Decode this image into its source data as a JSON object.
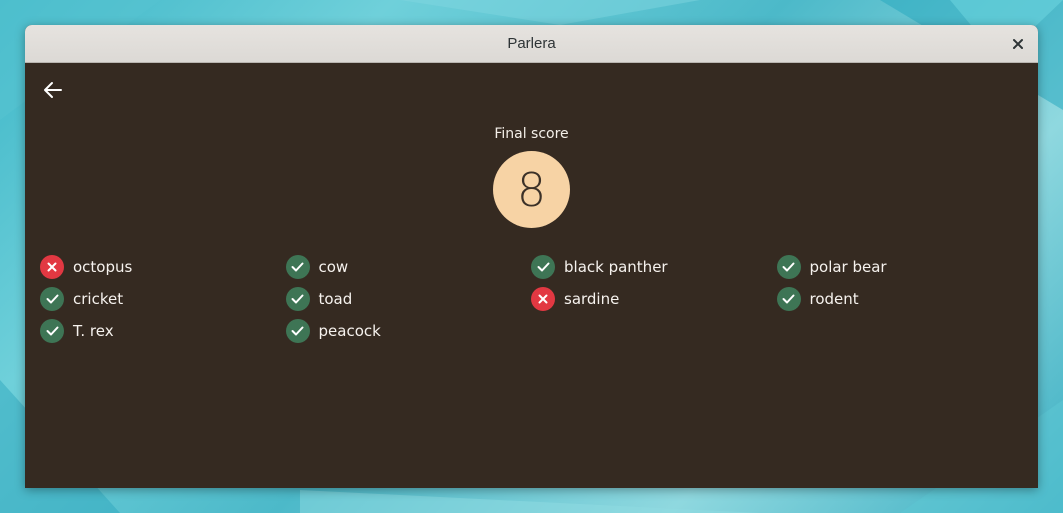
{
  "window": {
    "title": "Parlera"
  },
  "score": {
    "label": "Final score",
    "value": "8"
  },
  "results": [
    [
      {
        "word": "octopus",
        "status": "wrong"
      },
      {
        "word": "cow",
        "status": "correct"
      },
      {
        "word": "black panther",
        "status": "correct"
      },
      {
        "word": "polar bear",
        "status": "correct"
      }
    ],
    [
      {
        "word": "cricket",
        "status": "correct"
      },
      {
        "word": "toad",
        "status": "correct"
      },
      {
        "word": "sardine",
        "status": "wrong"
      },
      {
        "word": "rodent",
        "status": "correct"
      }
    ],
    [
      {
        "word": "T. rex",
        "status": "correct"
      },
      {
        "word": "peacock",
        "status": "correct"
      }
    ]
  ],
  "colors": {
    "window_bg": "#352a21",
    "score_circle": "#f7d3a5",
    "correct": "#3e7555",
    "wrong": "#e23842"
  },
  "icons": {
    "back": "arrow-left-icon",
    "close": "close-icon",
    "correct": "checkmark-icon",
    "wrong": "cross-icon"
  }
}
